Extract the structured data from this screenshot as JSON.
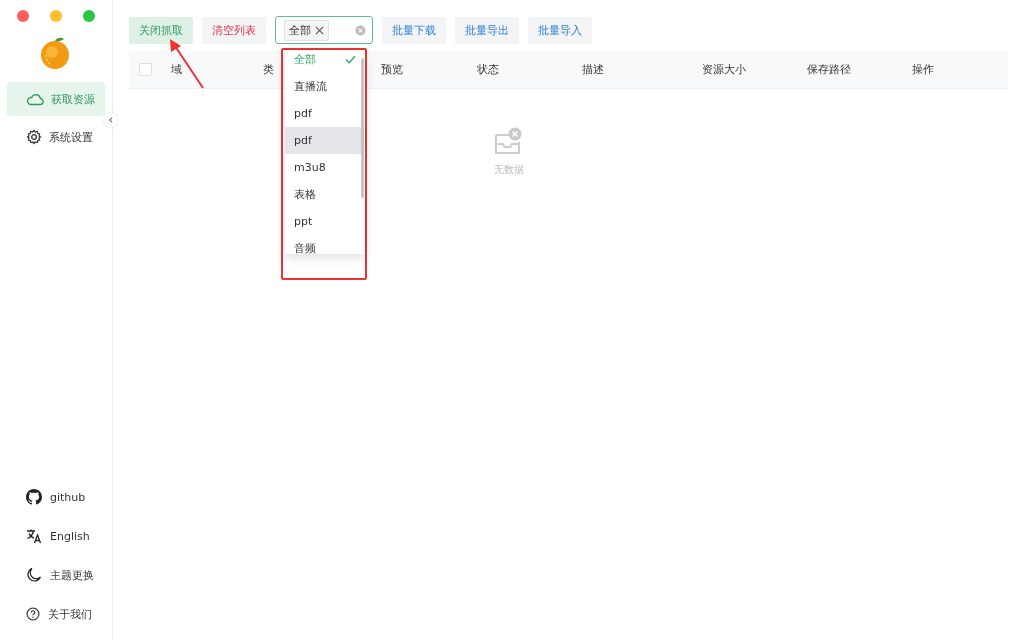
{
  "sidebar": {
    "items": [
      {
        "label": "获取资源",
        "selected": true
      },
      {
        "label": "系统设置",
        "selected": false
      }
    ],
    "footer": [
      {
        "label": "github"
      },
      {
        "label": "English"
      },
      {
        "label": "主题更换"
      },
      {
        "label": "关于我们"
      }
    ]
  },
  "toolbar": {
    "buttons": [
      {
        "label": "关闭抓取",
        "kind": "success"
      },
      {
        "label": "清空列表",
        "kind": "danger"
      },
      {
        "label": "批量下载",
        "kind": "primary"
      },
      {
        "label": "批量导出",
        "kind": "primary"
      },
      {
        "label": "批量导入",
        "kind": "primary"
      }
    ],
    "filter": {
      "tag": "全部"
    }
  },
  "table": {
    "select_all": {
      "checked": false
    },
    "columns": [
      "域",
      "类",
      "预览",
      "状态",
      "描述",
      "资源大小",
      "保存路径",
      "操作"
    ],
    "empty_text": "无数据"
  },
  "dropdown": {
    "options": [
      {
        "label": "全部",
        "selected": true,
        "hovered": false
      },
      {
        "label": "直播流",
        "selected": false,
        "hovered": false
      },
      {
        "label": "pdf",
        "selected": false,
        "hovered": false
      },
      {
        "label": "pdf",
        "selected": false,
        "hovered": true
      },
      {
        "label": "m3u8",
        "selected": false,
        "hovered": false
      },
      {
        "label": "表格",
        "selected": false,
        "hovered": false
      },
      {
        "label": "ppt",
        "selected": false,
        "hovered": false
      },
      {
        "label": "音频",
        "selected": false,
        "hovered": false
      }
    ]
  }
}
